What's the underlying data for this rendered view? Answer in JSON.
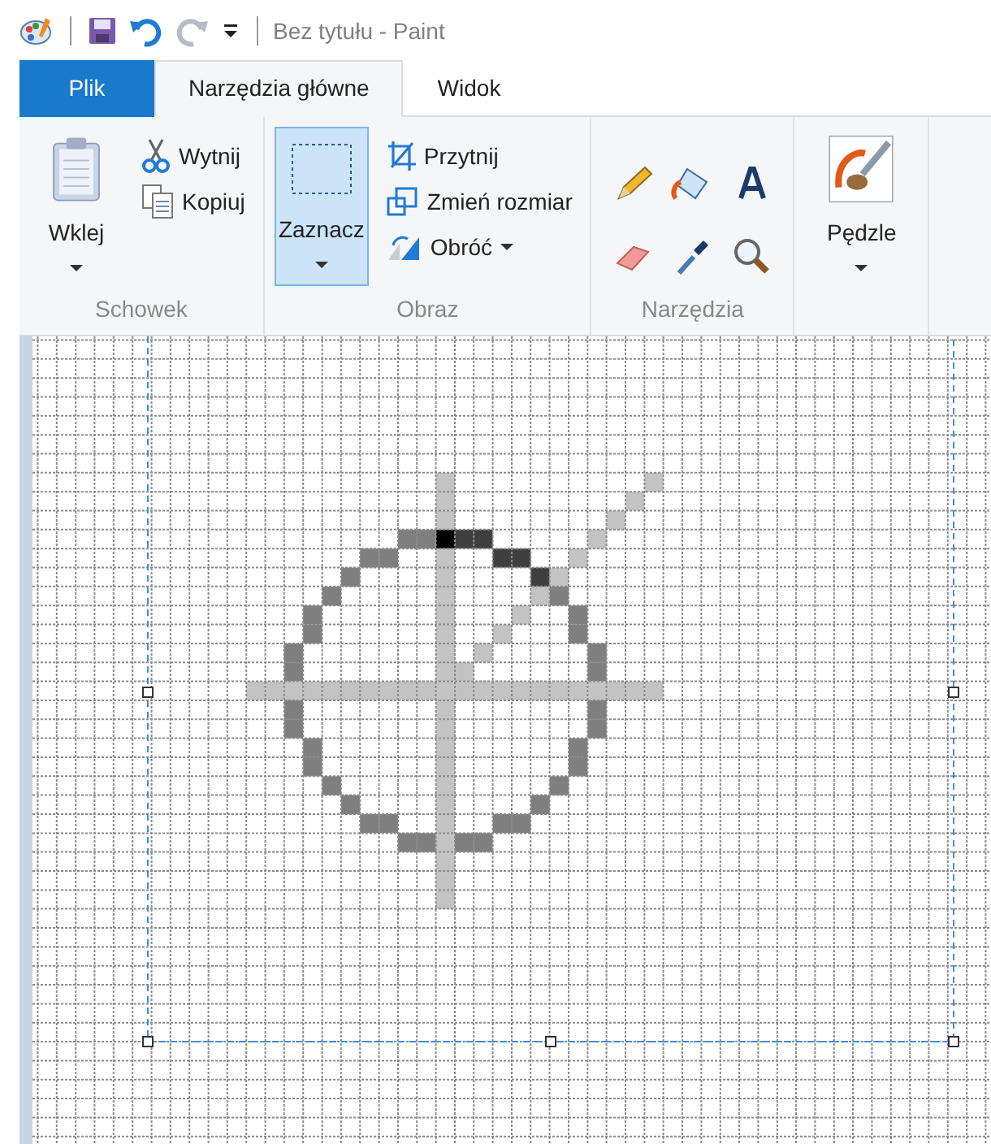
{
  "title_bar": {
    "title": "Bez tytułu - Paint"
  },
  "tabs": [
    {
      "label": "Plik",
      "kind": "file",
      "selected": false
    },
    {
      "label": "Narzędzia główne",
      "kind": "tab",
      "selected": true
    },
    {
      "label": "Widok",
      "kind": "tab",
      "selected": false
    }
  ],
  "ribbon": {
    "groups": [
      {
        "label": "Schowek",
        "kind": "buttons",
        "items": [
          {
            "label": "Wklej",
            "kind": "large",
            "dropdown": true,
            "selected": false
          },
          {
            "label": "Wytnij",
            "kind": "small",
            "dropdown": false,
            "selected": false
          },
          {
            "label": "Kopiuj",
            "kind": "small",
            "dropdown": false,
            "selected": false
          }
        ]
      },
      {
        "label": "Obraz",
        "kind": "buttons",
        "items": [
          {
            "label": "Zaznacz",
            "kind": "large",
            "dropdown": true,
            "selected": true
          },
          {
            "label": "Przytnij",
            "kind": "small",
            "dropdown": false,
            "selected": false
          },
          {
            "label": "Zmień rozmiar",
            "kind": "small",
            "dropdown": false,
            "selected": false
          },
          {
            "label": "Obróć",
            "kind": "small",
            "dropdown": true,
            "selected": false
          }
        ]
      },
      {
        "label": "Narzędzia",
        "kind": "tools"
      },
      {
        "kind": "buttons",
        "items": [
          {
            "label": "Pędzle",
            "kind": "large",
            "dropdown": true,
            "selected": false
          }
        ]
      }
    ]
  }
}
